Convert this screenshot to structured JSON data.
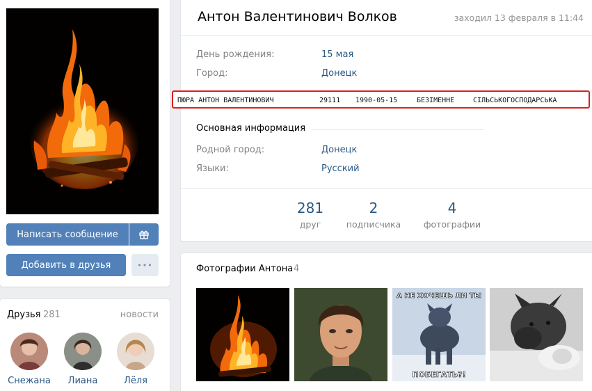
{
  "left": {
    "buttons": {
      "message": "Написать сообщение",
      "add_friend": "Добавить в друзья",
      "more": "•••"
    },
    "friends": {
      "title": "Друзья",
      "count": "281",
      "news_link": "новости",
      "items": [
        {
          "name": "Снежана"
        },
        {
          "name": "Лиана"
        },
        {
          "name": "Лёля"
        }
      ]
    }
  },
  "profile": {
    "name": "Антон Валентинович Волков",
    "last_seen": "заходил 13 февраля в 11:44",
    "fields": [
      {
        "label": "День рождения:",
        "value": "15 мая"
      },
      {
        "label": "Город:",
        "value": "Донецк"
      }
    ],
    "overlay": {
      "full_name": "ПЮРА АНТОН ВАЛЕНТИНОВИЧ",
      "code": "29111",
      "date": "1990-05-15",
      "place": "БЕЗІМЕННЕ",
      "category": "СІЛЬСЬКОГОСПОДАРСЬКА"
    },
    "basic_section_title": "Основная информация",
    "basic_fields": [
      {
        "label": "Родной город:",
        "value": "Донецк"
      },
      {
        "label": "Языки:",
        "value": "Русский"
      }
    ],
    "stats": [
      {
        "value": "281",
        "label": "друг"
      },
      {
        "value": "2",
        "label": "подписчика"
      },
      {
        "value": "4",
        "label": "фотографии"
      }
    ]
  },
  "photos": {
    "title": "Фотографии Антона",
    "count": "4",
    "meme_top_text": "А НЕ ХОЧЕШЬ ЛИ ТЫ",
    "meme_bottom_text": "ПОБЕГАТЬ?!"
  },
  "colors": {
    "accent": "#5181b8",
    "link": "#2a5885",
    "muted": "#828282",
    "highlight_border": "#d92020",
    "page_bg": "#edeef0"
  }
}
